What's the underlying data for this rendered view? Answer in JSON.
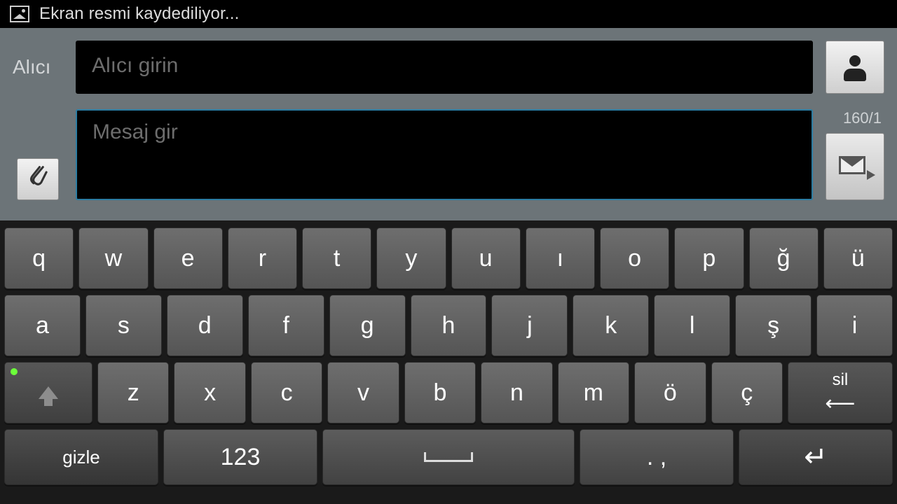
{
  "status": {
    "text": "Ekran resmi kaydediliyor..."
  },
  "compose": {
    "recipient_label": "Alıcı",
    "recipient_placeholder": "Alıcı girin",
    "message_placeholder": "Mesaj gir",
    "counter": "160/1"
  },
  "keyboard": {
    "row1": [
      "q",
      "w",
      "e",
      "r",
      "t",
      "y",
      "u",
      "ı",
      "o",
      "p",
      "ğ",
      "ü"
    ],
    "row2": [
      "a",
      "s",
      "d",
      "f",
      "g",
      "h",
      "j",
      "k",
      "l",
      "ş",
      "i"
    ],
    "row3_letters": [
      "z",
      "x",
      "c",
      "v",
      "b",
      "n",
      "m",
      "ö",
      "ç"
    ],
    "delete_label": "sil",
    "hide_label": "gizle",
    "numeric_label": "123",
    "punct_label": ". ,"
  }
}
